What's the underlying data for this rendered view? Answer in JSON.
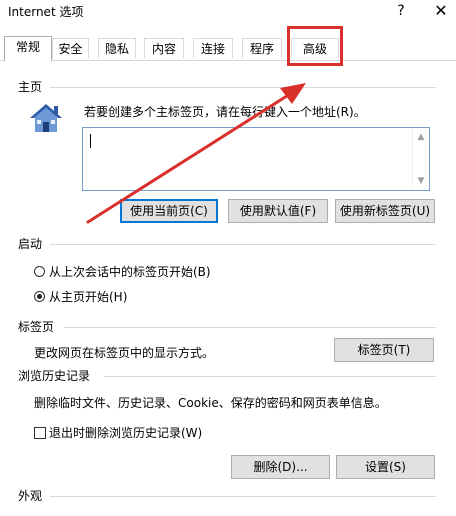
{
  "window": {
    "title": "Internet 选项",
    "help": "?",
    "close": "✕"
  },
  "tabs": [
    "常规",
    "安全",
    "隐私",
    "内容",
    "连接",
    "程序",
    "高级"
  ],
  "active_tab": "常规",
  "home": {
    "heading": "主页",
    "hint": "若要创建多个主标签页，请在每行键入一个地址(R)。",
    "value": "",
    "buttons": {
      "current": "使用当前页(C)",
      "default": "使用默认值(F)",
      "new_tab": "使用新标签页(U)"
    }
  },
  "startup": {
    "heading": "启动",
    "option_last": "从上次会话中的标签页开始(B)",
    "option_home": "从主页开始(H)",
    "selected": "option_home"
  },
  "tabs_section": {
    "heading": "标签页",
    "desc": "更改网页在标签页中的显示方式。",
    "button": "标签页(T)"
  },
  "history": {
    "heading": "浏览历史记录",
    "desc": "删除临时文件、历史记录、Cookie、保存的密码和网页表单信息。",
    "checkbox_label": "退出时删除浏览历史记录(W)",
    "checked": false,
    "delete_btn": "删除(D)...",
    "settings_btn": "设置(S)"
  },
  "appearance": {
    "heading": "外观"
  },
  "colors": {
    "annotation": "#d9302b",
    "focus": "#0078d7",
    "house_roof": "#2f5aa8",
    "house_body": "#6d9ad6"
  }
}
